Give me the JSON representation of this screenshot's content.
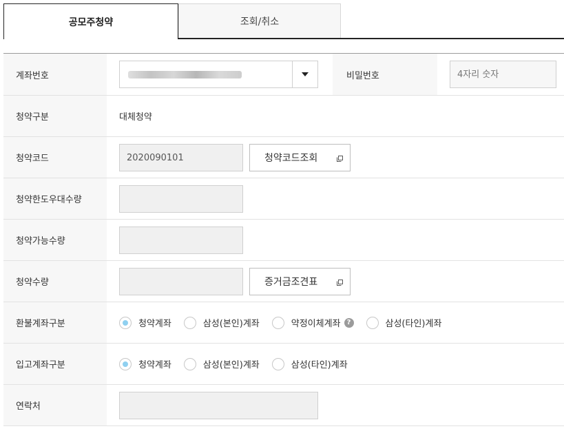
{
  "tabs": [
    {
      "label": "공모주청약"
    },
    {
      "label": "조회/취소"
    }
  ],
  "form": {
    "account": {
      "label": "계좌번호"
    },
    "password": {
      "label": "비밀번호",
      "placeholder": "4자리 숫자"
    },
    "sub_type": {
      "label": "청약구분",
      "value": "대체청약"
    },
    "sub_code": {
      "label": "청약코드",
      "value": "2020090101",
      "button": "청약코드조회"
    },
    "limit_qty": {
      "label": "청약한도우대수량"
    },
    "avail_qty": {
      "label": "청약가능수량"
    },
    "sub_qty": {
      "label": "청약수량",
      "button": "증거금조견표"
    },
    "refund": {
      "label": "환불계좌구분",
      "options": [
        "청약계좌",
        "삼성(본인)계좌",
        "약정이체계좌",
        "삼성(타인)계좌"
      ],
      "help": "?"
    },
    "deposit": {
      "label": "입고계좌구분",
      "options": [
        "청약계좌",
        "삼성(본인)계좌",
        "삼성(타인)계좌"
      ]
    },
    "contact": {
      "label": "연락처"
    }
  },
  "colors": {
    "radio_selected": "#8fd0f0",
    "label_bg": "#f7f7f7",
    "field_bg": "#f0f0f0"
  }
}
